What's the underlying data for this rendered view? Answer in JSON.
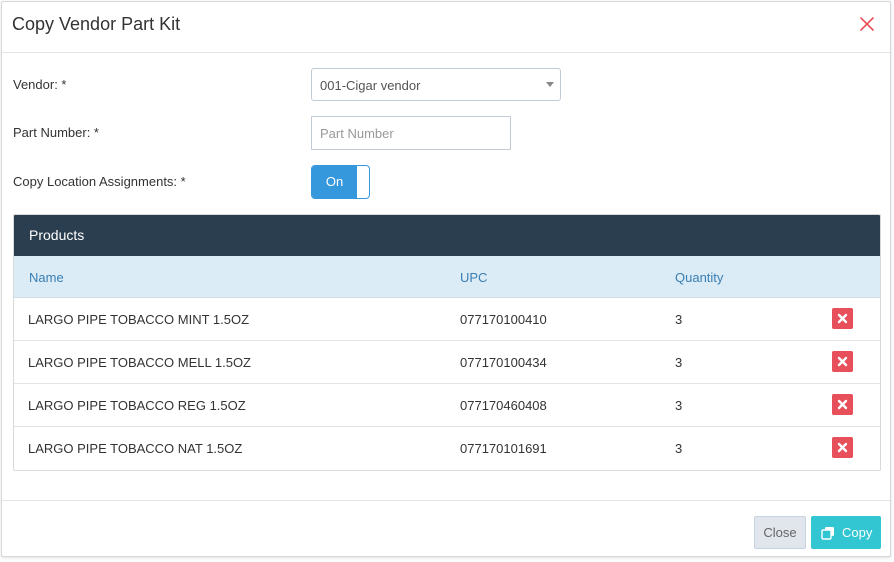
{
  "modal": {
    "title": "Copy Vendor Part Kit",
    "close_icon": "close-icon"
  },
  "form": {
    "vendor_label": "Vendor: *",
    "vendor_value": "001-Cigar vendor",
    "part_number_label": "Part Number: *",
    "part_number_value": "",
    "part_number_placeholder": "Part Number",
    "copy_location_label": "Copy Location Assignments: *",
    "copy_location_toggle": "On"
  },
  "products": {
    "title": "Products",
    "columns": [
      "Name",
      "UPC",
      "Quantity"
    ],
    "rows": [
      {
        "name": "LARGO PIPE TOBACCO MINT 1.5OZ",
        "upc": "077170100410",
        "quantity": "3"
      },
      {
        "name": "LARGO PIPE TOBACCO MELL 1.5OZ",
        "upc": "077170100434",
        "quantity": "3"
      },
      {
        "name": "LARGO PIPE TOBACCO REG 1.5OZ",
        "upc": "077170460408",
        "quantity": "3"
      },
      {
        "name": "LARGO PIPE TOBACCO NAT 1.5OZ",
        "upc": "077170101691",
        "quantity": "3"
      }
    ],
    "row_action_icon": "delete-icon"
  },
  "footer": {
    "close_label": "Close",
    "copy_label": "Copy",
    "copy_icon": "copy-icon"
  },
  "colors": {
    "header_bar": "#2b3e50",
    "table_header": "#dbecf6",
    "toggle_on": "#3598dc",
    "delete": "#e7505a",
    "copy_button": "#32c5d2",
    "close_x": "#e7505a"
  }
}
